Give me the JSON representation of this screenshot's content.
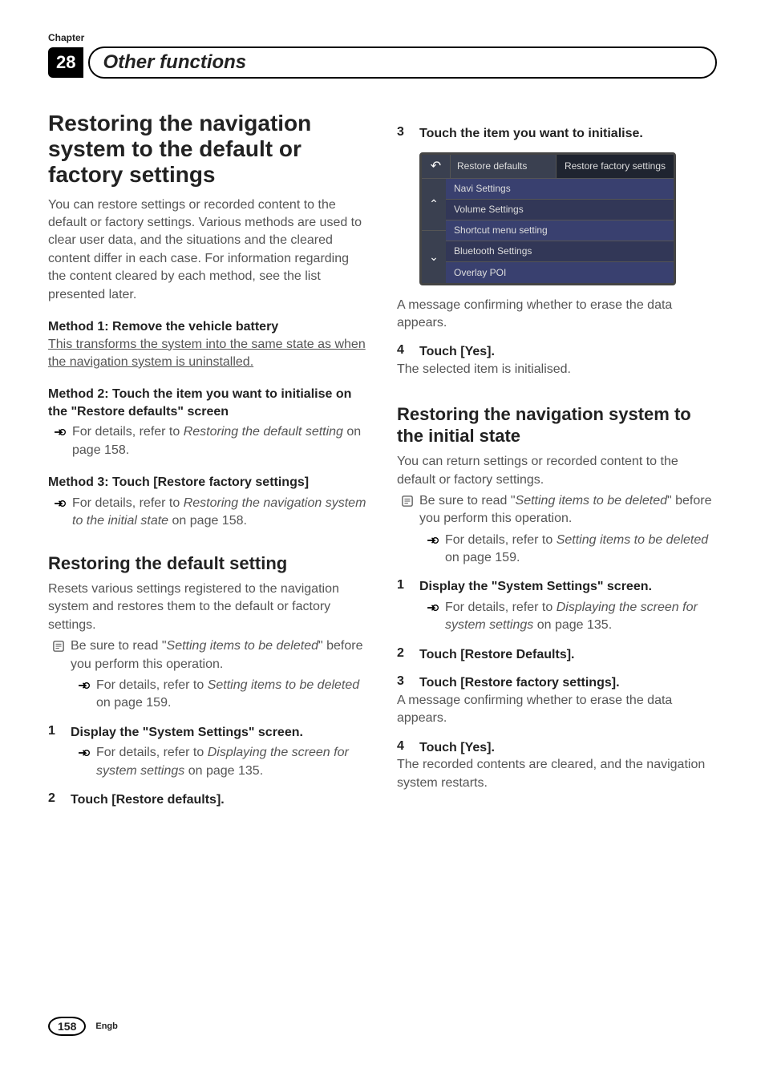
{
  "header": {
    "chapter_label": "Chapter",
    "chapter_number": "28",
    "chapter_title": "Other functions"
  },
  "left": {
    "h1": "Restoring the navigation system to the default or factory settings",
    "intro": "You can restore settings or recorded content to the default or factory settings. Various methods are used to clear user data, and the situations and the cleared content differ in each case. For information regarding the content cleared by each method, see the list presented later.",
    "method1_title": "Method 1: Remove the vehicle battery",
    "method1_body": "This transforms the system into the same state as when the navigation system is uninstalled.",
    "method2_title_a": "Method 2: Touch the item you want to initialise on the \"",
    "method2_title_b": "Restore defaults",
    "method2_title_c": "\" screen",
    "method2_ref_a": "For details, refer to ",
    "method2_ref_i": "Restoring the default setting",
    "method2_ref_b": " on page 158.",
    "method3_title_a": "Method 3: Touch [",
    "method3_title_b": "Restore factory settings",
    "method3_title_c": "]",
    "method3_ref_a": "For details, refer to ",
    "method3_ref_i": "Restoring the navigation system to the initial state",
    "method3_ref_b": " on page 158.",
    "h2": "Restoring the default setting",
    "h2_intro": "Resets various settings registered to the navigation system and restores them to the default or factory settings.",
    "note_a": "Be sure to read \"",
    "note_i": "Setting items to be deleted",
    "note_b": "\" before you perform this operation.",
    "note_ref_a": "For details, refer to ",
    "note_ref_i": "Setting items to be deleted",
    "note_ref_b": " on page 159.",
    "step1_num": "1",
    "step1_text": "Display the \"System Settings\" screen.",
    "step1_ref_a": "For details, refer to ",
    "step1_ref_i": "Displaying the screen for system settings",
    "step1_ref_b": " on page 135.",
    "step2_num": "2",
    "step2_text": "Touch [Restore defaults]."
  },
  "right": {
    "step3_num": "3",
    "step3_text": "Touch the item you want to initialise.",
    "screenshot": {
      "title": "Restore defaults",
      "factory": "Restore factory settings",
      "items": [
        "Navi Settings",
        "Volume Settings",
        "Shortcut menu setting",
        "Bluetooth Settings",
        "Overlay POI"
      ]
    },
    "after_ss": "A message confirming whether to erase the data appears.",
    "step4_num": "4",
    "step4_text": "Touch [Yes].",
    "step4_body": "The selected item is initialised.",
    "h2": "Restoring the navigation system to the initial state",
    "h2_intro": "You can return settings or recorded content to the default or factory settings.",
    "note_a": "Be sure to read \"",
    "note_i": "Setting items to be deleted",
    "note_b": "\" before you perform this operation.",
    "note_ref_a": "For details, refer to ",
    "note_ref_i": "Setting items to be deleted",
    "note_ref_b": " on page 159.",
    "step1_num": "1",
    "step1_text": "Display the \"System Settings\" screen.",
    "step1_ref_a": "For details, refer to ",
    "step1_ref_i": "Displaying the screen for system settings",
    "step1_ref_b": " on page 135.",
    "step2_num": "2",
    "step2_text": "Touch [Restore Defaults].",
    "step3b_num": "3",
    "step3b_text": "Touch [Restore factory settings].",
    "step3b_body": "A message confirming whether to erase the data appears.",
    "step4b_num": "4",
    "step4b_text": "Touch [Yes].",
    "step4b_body": "The recorded contents are cleared, and the navigation system restarts."
  },
  "footer": {
    "page": "158",
    "engb": "Engb"
  }
}
